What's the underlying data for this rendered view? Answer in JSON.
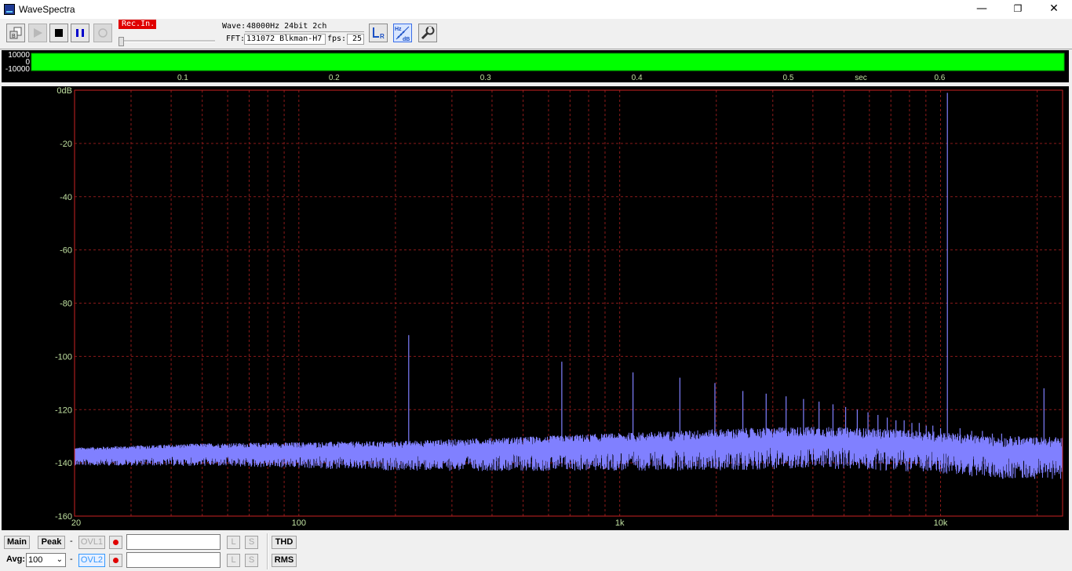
{
  "window": {
    "title": "WaveSpectra",
    "minimize": "—",
    "maximize": "❐",
    "close": "✕"
  },
  "toolbar": {
    "rec_label": "Rec.In.",
    "wave_label": "Wave:",
    "wave_value": "48000Hz 24bit 2ch",
    "fft_label": "FFT:",
    "fft_value": "131072 Blkman-H7",
    "fps_label": "fps:",
    "fps_value": "25",
    "lr_button": "LR",
    "hzdb_button": "Hz dB"
  },
  "wave_display": {
    "y_labels": [
      "10000",
      "0",
      "-10000"
    ],
    "time_ticks": [
      "0.1",
      "0.2",
      "0.3",
      "0.4",
      "0.5",
      "0.6"
    ],
    "time_unit": "sec",
    "colors": {
      "wave_fill": "#00ff00",
      "wave_edge": "#00aa00"
    }
  },
  "spectrum": {
    "y_ticks": [
      "0dB",
      "-20",
      "-40",
      "-60",
      "-80",
      "-100",
      "-120",
      "-140",
      "-160"
    ],
    "x_ticks": [
      "20",
      "100",
      "1k",
      "10k"
    ],
    "colors": {
      "grid": "#8b1a1a",
      "frame": "#cc2222",
      "trace": "#8080ff",
      "label": "#c0e0a0"
    }
  },
  "bottom": {
    "main_button": "Main",
    "peak_button": "Peak",
    "dash": "-",
    "ovl1_button": "OVL1",
    "ovl2_button": "OVL2",
    "l_button": "L",
    "s_button": "S",
    "thd_button": "THD",
    "rms_button": "RMS",
    "avg_label": "Avg:",
    "avg_value": "100"
  },
  "chart_data": {
    "type": "line",
    "x_scale": "log",
    "xlim": [
      20,
      24000
    ],
    "ylim": [
      -160,
      0
    ],
    "x_tick_labels": [
      "20",
      "100",
      "1k",
      "10k"
    ],
    "y_tick_labels": [
      "0dB",
      "-20",
      "-40",
      "-60",
      "-80",
      "-100",
      "-120",
      "-140",
      "-160"
    ],
    "noise_floor": [
      [
        20,
        -137
      ],
      [
        50,
        -136
      ],
      [
        100,
        -136
      ],
      [
        200,
        -136
      ],
      [
        500,
        -135
      ],
      [
        1000,
        -134
      ],
      [
        2000,
        -133
      ],
      [
        4000,
        -132
      ],
      [
        7000,
        -133
      ],
      [
        10000,
        -134
      ],
      [
        15000,
        -136
      ],
      [
        24000,
        -136
      ]
    ],
    "peaks": [
      {
        "f": 220,
        "db": -92
      },
      {
        "f": 660,
        "db": -102
      },
      {
        "f": 1100,
        "db": -106
      },
      {
        "f": 1540,
        "db": -108
      },
      {
        "f": 1980,
        "db": -110
      },
      {
        "f": 2420,
        "db": -113
      },
      {
        "f": 2860,
        "db": -114
      },
      {
        "f": 3300,
        "db": -115
      },
      {
        "f": 3740,
        "db": -116
      },
      {
        "f": 4180,
        "db": -117
      },
      {
        "f": 4620,
        "db": -118
      },
      {
        "f": 5060,
        "db": -119
      },
      {
        "f": 5500,
        "db": -120
      },
      {
        "f": 5940,
        "db": -121
      },
      {
        "f": 6380,
        "db": -122
      },
      {
        "f": 6820,
        "db": -123
      },
      {
        "f": 7260,
        "db": -124
      },
      {
        "f": 7700,
        "db": -124
      },
      {
        "f": 8140,
        "db": -125
      },
      {
        "f": 8580,
        "db": -125
      },
      {
        "f": 9020,
        "db": -126
      },
      {
        "f": 9460,
        "db": -126
      },
      {
        "f": 10000,
        "db": -127
      },
      {
        "f": 10500,
        "db": -1
      },
      {
        "f": 11500,
        "db": -127
      },
      {
        "f": 12500,
        "db": -128
      },
      {
        "f": 13500,
        "db": -128
      },
      {
        "f": 14500,
        "db": -129
      },
      {
        "f": 15500,
        "db": -129
      },
      {
        "f": 16500,
        "db": -130
      },
      {
        "f": 17500,
        "db": -130
      },
      {
        "f": 18500,
        "db": -131
      },
      {
        "f": 19500,
        "db": -131
      },
      {
        "f": 21000,
        "db": -112
      }
    ]
  }
}
